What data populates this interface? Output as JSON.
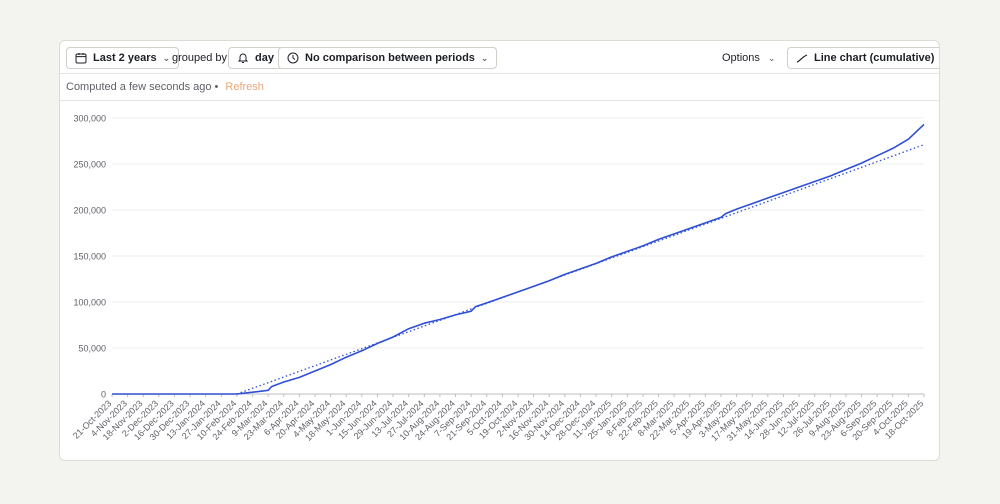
{
  "toolbar": {
    "date_range": "Last 2 years",
    "grouped_by_label": "grouped by",
    "interval": "day",
    "comparison": "No comparison between periods",
    "options_label": "Options",
    "chart_type": "Line chart (cumulative)"
  },
  "status": {
    "computed": "Computed a few seconds ago",
    "separator": "•",
    "refresh": "Refresh"
  },
  "colors": {
    "line": "#2f4fd6",
    "trend": "#2f4fd6",
    "refresh": "#e8a77a",
    "grid": "#ececec"
  },
  "chart_data": {
    "type": "line",
    "title": "",
    "xlabel": "",
    "ylabel": "",
    "ylim": [
      0,
      300000
    ],
    "yticks": [
      0,
      50000,
      100000,
      150000,
      200000,
      250000,
      300000
    ],
    "ytick_labels": [
      "0",
      "50,000",
      "100,000",
      "150,000",
      "200,000",
      "250,000",
      "300,000"
    ],
    "x_range": [
      "21-Oct-2023",
      "18-Oct-2025"
    ],
    "xtick_labels": [
      "21-Oct-2023",
      "4-Nov-2023",
      "18-Nov-2023",
      "2-Dec-2023",
      "16-Dec-2023",
      "30-Dec-2023",
      "13-Jan-2024",
      "27-Jan-2024",
      "10-Feb-2024",
      "24-Feb-2024",
      "9-Mar-2024",
      "23-Mar-2024",
      "6-Apr-2024",
      "20-Apr-2024",
      "4-May-2024",
      "18-May-2024",
      "1-Jun-2024",
      "15-Jun-2024",
      "29-Jun-2024",
      "13-Jul-2024",
      "27-Jul-2024",
      "10-Aug-2024",
      "24-Aug-2024",
      "7-Sep-2024",
      "21-Sep-2024",
      "5-Oct-2024",
      "19-Oct-2024",
      "2-Nov-2024",
      "16-Nov-2024",
      "30-Nov-2024",
      "14-Dec-2024",
      "28-Dec-2024",
      "11-Jan-2025",
      "25-Jan-2025",
      "8-Feb-2025",
      "22-Feb-2025",
      "8-Mar-2025",
      "22-Mar-2025",
      "5-Apr-2025",
      "19-Apr-2025",
      "3-May-2025",
      "17-May-2025",
      "31-May-2025",
      "14-Jun-2025",
      "28-Jun-2025",
      "12-Jul-2025",
      "26-Jul-2025",
      "9-Aug-2025",
      "23-Aug-2025",
      "6-Sep-2025",
      "20-Sep-2025",
      "4-Oct-2025",
      "18-Oct-2025"
    ],
    "grid": true,
    "legend": "none",
    "series": [
      {
        "style": "solid",
        "x": [
          "21-Oct-2023",
          "10-Feb-2024",
          "24-Feb-2024",
          "9-Mar-2024",
          "12-Mar-2024",
          "23-Mar-2024",
          "6-Apr-2024",
          "20-Apr-2024",
          "4-May-2024",
          "18-May-2024",
          "1-Jun-2024",
          "15-Jun-2024",
          "29-Jun-2024",
          "13-Jul-2024",
          "27-Jul-2024",
          "10-Aug-2024",
          "24-Aug-2024",
          "7-Sep-2024",
          "11-Sep-2024",
          "21-Sep-2024",
          "5-Oct-2024",
          "19-Oct-2024",
          "2-Nov-2024",
          "16-Nov-2024",
          "30-Nov-2024",
          "14-Dec-2024",
          "28-Dec-2024",
          "11-Jan-2025",
          "25-Jan-2025",
          "8-Feb-2025",
          "22-Feb-2025",
          "8-Mar-2025",
          "22-Mar-2025",
          "5-Apr-2025",
          "19-Apr-2025",
          "23-Apr-2025",
          "3-May-2025",
          "17-May-2025",
          "31-May-2025",
          "14-Jun-2025",
          "28-Jun-2025",
          "12-Jul-2025",
          "26-Jul-2025",
          "9-Aug-2025",
          "23-Aug-2025",
          "6-Sep-2025",
          "20-Sep-2025",
          "4-Oct-2025",
          "18-Oct-2025"
        ],
        "y": [
          0,
          0,
          2000,
          4000,
          8000,
          13000,
          18000,
          25000,
          32000,
          40000,
          47000,
          55000,
          62000,
          71000,
          77000,
          81000,
          86000,
          90000,
          95000,
          99000,
          105000,
          111000,
          117000,
          123000,
          130000,
          136000,
          142000,
          149000,
          155000,
          161000,
          168000,
          174000,
          180000,
          186000,
          192000,
          196000,
          201000,
          207000,
          213000,
          219000,
          225000,
          231000,
          237000,
          244000,
          251000,
          259000,
          267000,
          277000,
          293000
        ]
      },
      {
        "style": "dotted",
        "x": [
          "10-Feb-2024",
          "18-Oct-2025"
        ],
        "y": [
          0,
          271000
        ]
      }
    ]
  }
}
